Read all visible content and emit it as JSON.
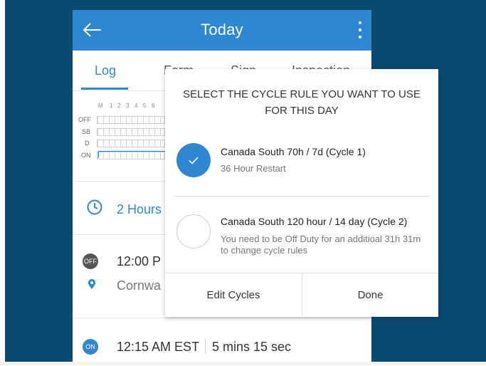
{
  "header": {
    "title": "Today",
    "back_icon": "arrow-left-icon",
    "menu_icon": "kebab-menu-icon"
  },
  "tabs": [
    {
      "label": "Log",
      "active": true
    },
    {
      "label": "Form",
      "active": false
    },
    {
      "label": "Sign",
      "active": false
    },
    {
      "label": "Inspection",
      "active": false
    }
  ],
  "graph": {
    "hours": [
      "M",
      "1",
      "2",
      "3",
      "4",
      "5",
      "6"
    ],
    "statuses": [
      "OFF",
      "SB",
      "D",
      "ON"
    ]
  },
  "summary": {
    "hours_text": "2 Hours"
  },
  "events": [
    {
      "badge": "OFF",
      "time": "12:00 P",
      "location": "Cornwa",
      "badge_color": "#555555"
    },
    {
      "badge": "ON",
      "time": "12:15 AM EST",
      "duration": "5 mins 15 sec",
      "badge_color": "#2f86d1"
    }
  ],
  "dialog": {
    "title": "SELECT THE CYCLE RULE YOU WANT TO USE FOR THIS DAY",
    "options": [
      {
        "name": "Canada South 70h / 7d (Cycle 1)",
        "desc": "36 Hour Restart",
        "selected": true
      },
      {
        "name": "Canada South 120 hour / 14 day (Cycle 2)",
        "desc": "You need to be Off Duty for an additioal 31h 31m to change cycle rules",
        "selected": false
      }
    ],
    "edit_label": "Edit Cycles",
    "done_label": "Done"
  },
  "colors": {
    "accent": "#2f86d1",
    "backdrop": "#0b4a70"
  }
}
